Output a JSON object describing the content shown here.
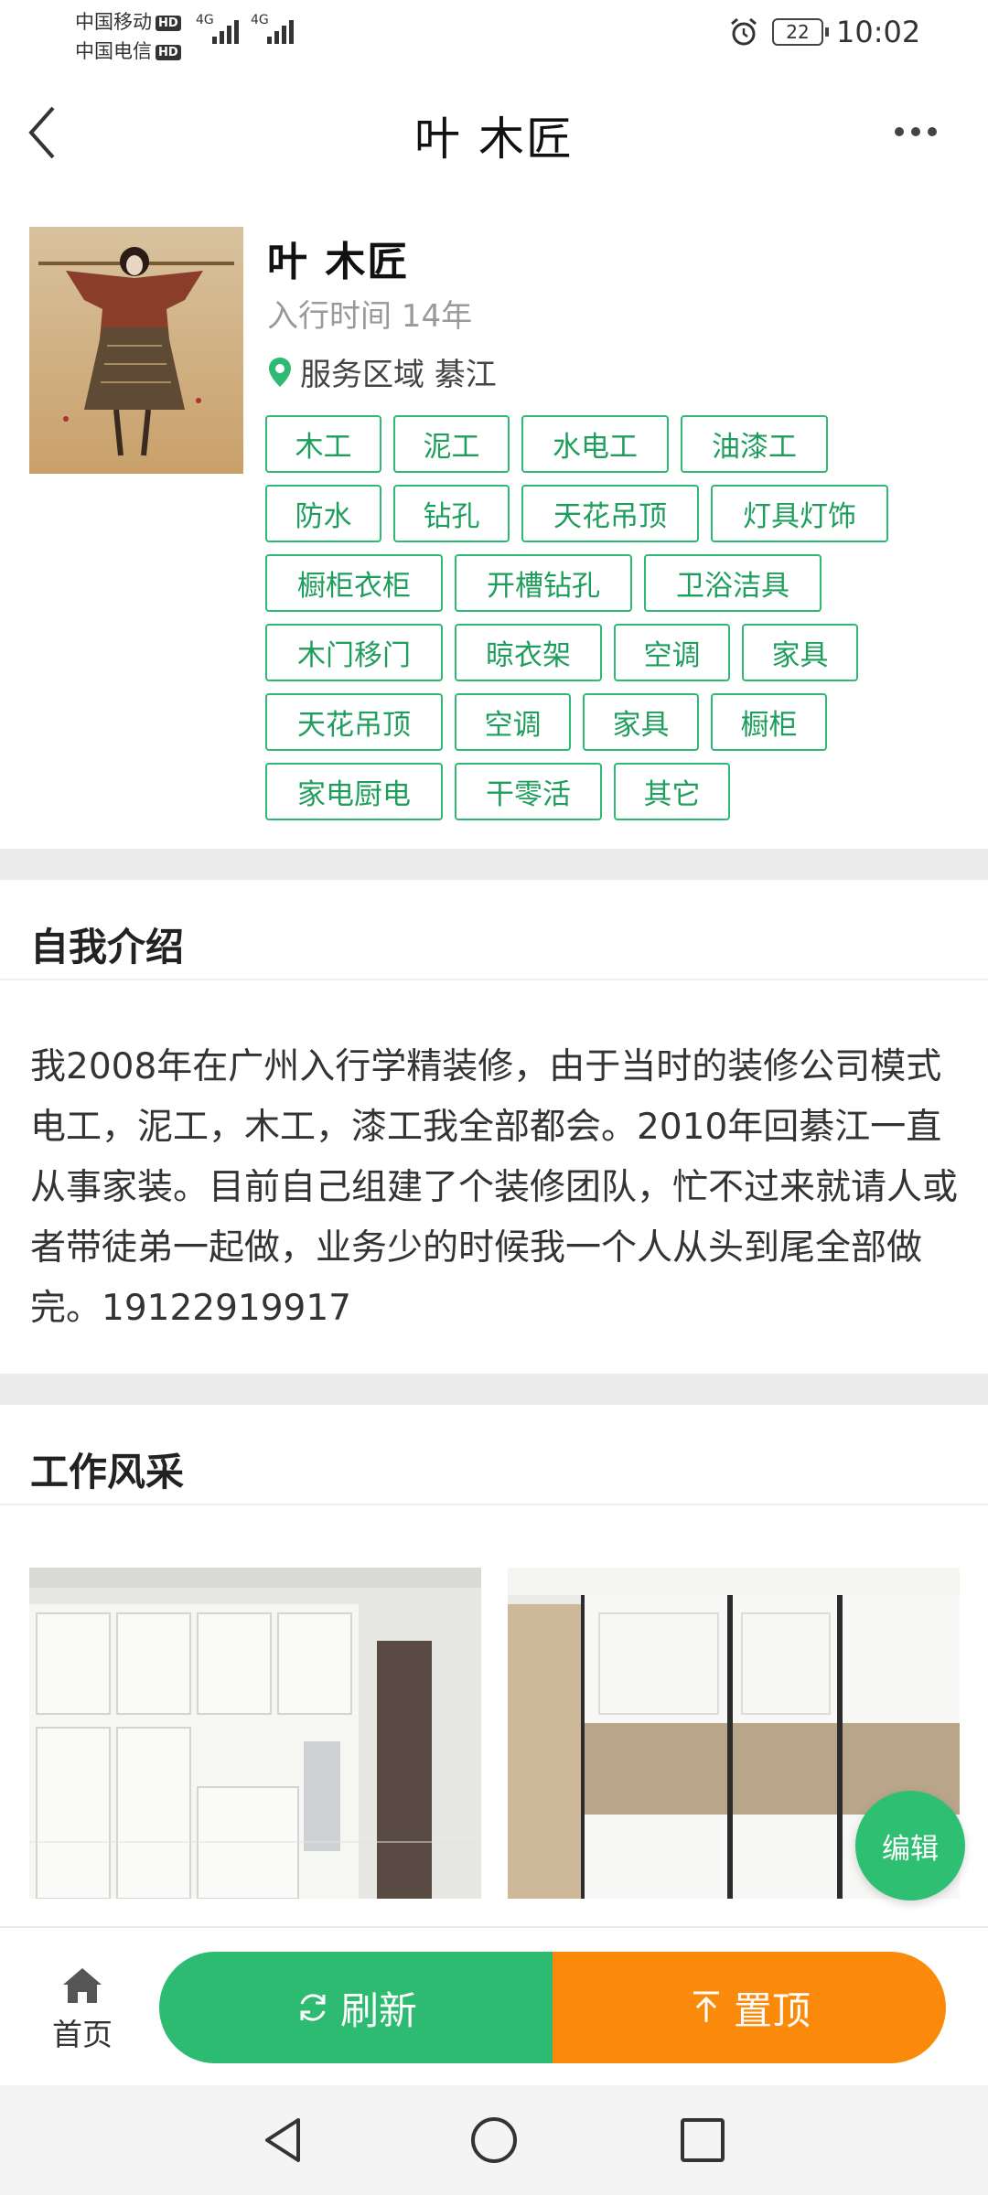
{
  "status_bar": {
    "carrier1": "中国移动",
    "carrier2": "中国电信",
    "hd": "HD",
    "network1": "4G",
    "network2": "4G",
    "battery": "22",
    "time": "10:02"
  },
  "header": {
    "title": "叶 木匠"
  },
  "profile": {
    "name": "叶 木匠",
    "years": "入行时间 14年",
    "area": "服务区域  綦江",
    "tag_rows": [
      [
        "木工",
        "泥工",
        "水电工",
        "油漆工"
      ],
      [
        "防水",
        "钻孔",
        "天花吊顶",
        "灯具灯饰"
      ],
      [
        "橱柜衣柜",
        "开槽钻孔",
        "卫浴洁具"
      ],
      [
        "木门移门",
        "晾衣架",
        "空调",
        "家具"
      ],
      [
        "天花吊顶",
        "空调",
        "家具",
        "橱柜"
      ],
      [
        "家电厨电",
        "干零活",
        "其它"
      ]
    ]
  },
  "intro": {
    "title": "自我介绍",
    "text": "我2008年在广州入行学精装修，由于当时的装修公司模式 电工，泥工，木工，漆工我全部都会。2010年回綦江一直从事家装。目前自己组建了个装修团队，忙不过来就请人或者带徒弟一起做，业务少的时候我一个人从头到尾全部做完。19122919917"
  },
  "gallery": {
    "title": "工作风采"
  },
  "edit_label": "编辑",
  "bottom": {
    "home_label": "首页",
    "refresh_label": "刷新",
    "top_label": "置顶"
  },
  "colors": {
    "accent_green": "#2dbb71",
    "accent_orange": "#fb8a0a",
    "divider": "#ececec"
  },
  "icons": [
    "back-icon",
    "more-icon",
    "location-pin-icon",
    "home-icon",
    "refresh-icon",
    "pin-top-icon",
    "alarm-icon",
    "nav-back-icon",
    "nav-home-icon",
    "nav-recents-icon"
  ]
}
